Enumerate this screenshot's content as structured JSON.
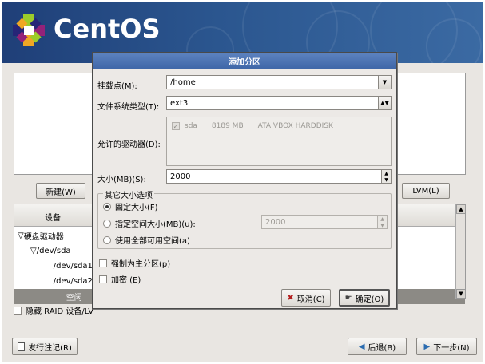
{
  "header": {
    "brand": "CentOS"
  },
  "background": {
    "new_button": "新建(W)",
    "lvm_button": "LVM(L)",
    "device_header": "设备",
    "tree": [
      {
        "label": "硬盘驱动器",
        "indent": 0,
        "prefix": "▽"
      },
      {
        "label": "/dev/sda",
        "indent": 1,
        "prefix": "▽"
      },
      {
        "label": "/dev/sda1",
        "indent": 2,
        "prefix": ""
      },
      {
        "label": "/dev/sda2",
        "indent": 2,
        "prefix": ""
      },
      {
        "label": "空闲",
        "indent": 2,
        "prefix": ""
      }
    ],
    "hide_raid": "隐藏 RAID 设备/LV",
    "release_notes": "发行注记(R)",
    "back_button": "后退(B)",
    "next_button": "下一步(N)"
  },
  "dialog": {
    "title": "添加分区",
    "mount_label": "挂载点(M):",
    "mount_value": "/home",
    "fs_label": "文件系统类型(T):",
    "fs_value": "ext3",
    "drives_label": "允许的驱动器(D):",
    "drive": {
      "name": "sda",
      "size": "8189 MB",
      "model": "ATA VBOX HARDDISK",
      "checked": true
    },
    "size_label": "大小(MB)(S):",
    "size_value": "2000",
    "size_options_title": "其它大小选项",
    "opt_fixed": "固定大小(F)",
    "opt_max": "指定空间大小(MB)(u):",
    "opt_max_value": "2000",
    "opt_fill": "使用全部可用空间(a)",
    "selected_option": "fixed",
    "force_primary": "强制为主分区(p)",
    "encrypt": "加密 (E)",
    "cancel_button": "取消(C)",
    "ok_button": "确定(O)"
  }
}
